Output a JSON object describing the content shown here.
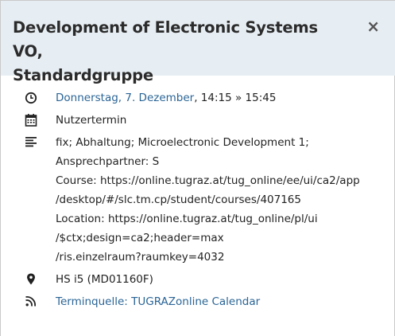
{
  "dialog": {
    "title_line1": "Development of Electronic Systems VO,",
    "title_line2": "Standardgruppe",
    "close_label": "×"
  },
  "event": {
    "date_link": "Donnerstag, 7. Dezember",
    "time_range": ", 14:15 » 15:45",
    "type": "Nutzertermin",
    "description_lines": [
      "fix; Abhaltung; Microelectronic Development 1;",
      "Ansprechpartner: S",
      "Course: https://online.tugraz.at/tug_online/ee/ui/ca2/app",
      "/desktop/#/slc.tm.cp/student/courses/407165",
      "Location: https://online.tugraz.at/tug_online/pl/ui",
      "/$ctx;design=ca2;header=max",
      "/ris.einzelraum?raumkey=4032"
    ],
    "location": "HS i5 (MD01160F)",
    "source_link": "Terminquelle: TUGRAZonline Calendar"
  },
  "icons": {
    "time": "clock-icon",
    "type": "calendar-icon",
    "description": "align-left-icon",
    "location": "map-marker-icon",
    "source": "rss-icon"
  },
  "colors": {
    "header_bg": "#e7eef3",
    "link": "#2a6496",
    "text": "#222222"
  }
}
